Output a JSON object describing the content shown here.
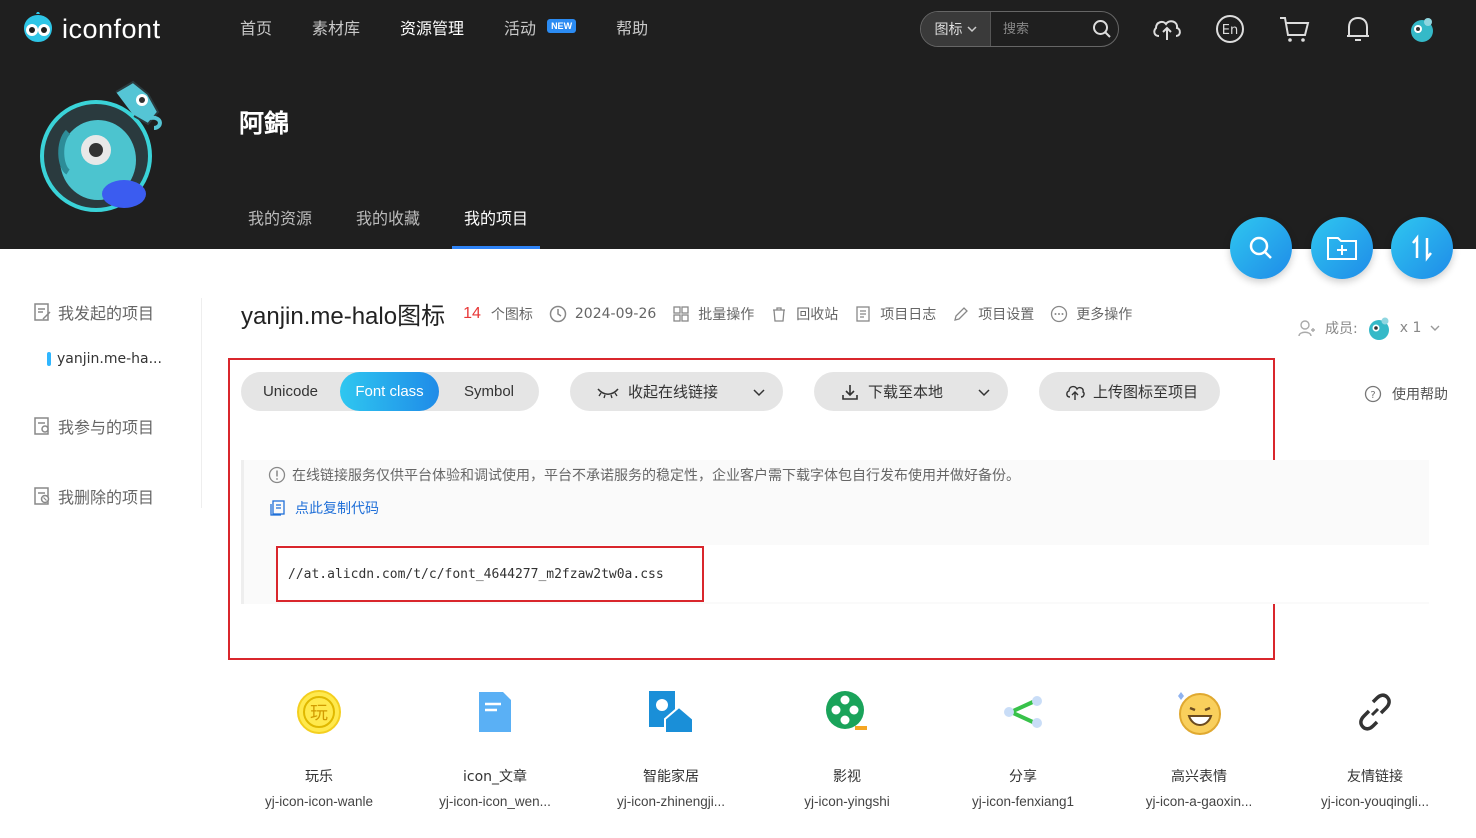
{
  "brand": {
    "name": "iconfont"
  },
  "nav": {
    "items": [
      {
        "label": "首页"
      },
      {
        "label": "素材库"
      },
      {
        "label": "资源管理"
      },
      {
        "label": "活动"
      },
      {
        "label": "帮助"
      }
    ],
    "new_badge": "NEW"
  },
  "search": {
    "type_label": "图标",
    "placeholder": "搜索"
  },
  "profile": {
    "username": "阿錦"
  },
  "subnav": {
    "items": [
      {
        "label": "我的资源"
      },
      {
        "label": "我的收藏"
      },
      {
        "label": "我的项目"
      }
    ]
  },
  "sidebar": {
    "initiated": "我发起的项目",
    "current_project": "yanjin.me-ha...",
    "joined": "我参与的项目",
    "deleted": "我删除的项目"
  },
  "project": {
    "title": "yanjin.me-halo图标",
    "count": "14",
    "count_unit": "个图标",
    "date": "2024-09-26",
    "batch": "批量操作",
    "recycle": "回收站",
    "log": "项目日志",
    "settings": "项目设置",
    "more": "更多操作",
    "members_label": "成员:",
    "members_count": "x 1"
  },
  "format_tabs": [
    "Unicode",
    "Font class",
    "Symbol"
  ],
  "actions": {
    "collapse_link": "收起在线链接",
    "download": "下载至本地",
    "upload": "上传图标至项目",
    "help": "使用帮助"
  },
  "notice": "在线链接服务仅供平台体验和调试使用，平台不承诺服务的稳定性，企业客户需下载字体包自行发布使用并做好备份。",
  "copy_code": "点此复制代码",
  "css_url": "//at.alicdn.com/t/c/font_4644277_m2fzaw2tw0a.css",
  "icons": [
    {
      "name": "玩乐",
      "cls": "yj-icon-icon-wanle",
      "icon": "play-icon"
    },
    {
      "name": "icon_文章",
      "cls": "yj-icon-icon_wen...",
      "icon": "article-icon"
    },
    {
      "name": "智能家居",
      "cls": "yj-icon-zhinengji...",
      "icon": "smart-home-icon"
    },
    {
      "name": "影视",
      "cls": "yj-icon-yingshi",
      "icon": "film-reel-icon"
    },
    {
      "name": "分享",
      "cls": "yj-icon-fenxiang1",
      "icon": "share-icon"
    },
    {
      "name": "高兴表情",
      "cls": "yj-icon-a-gaoxin...",
      "icon": "happy-face-icon"
    },
    {
      "name": "友情链接",
      "cls": "yj-icon-youqingli...",
      "icon": "link-icon"
    }
  ],
  "colors": {
    "accent": "#2e83f6",
    "gradient_start": "#2fc7f0",
    "gradient_end": "#1f8be8",
    "highlight": "#d9262c",
    "count": "#e83737"
  }
}
